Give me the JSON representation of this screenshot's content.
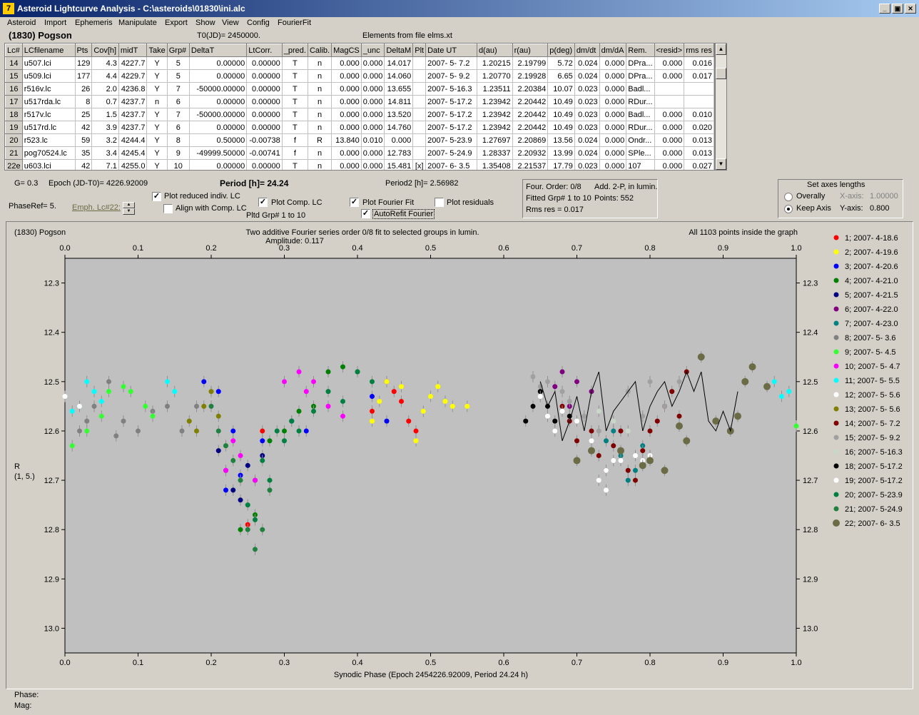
{
  "window": {
    "title": "Asteroid Lightcurve Analysis - C:\\asteroids\\01830\\ini.alc",
    "buttons": {
      "minimize": "_",
      "restore": "▣",
      "close": "✕"
    }
  },
  "menu": [
    "Asteroid",
    "Import",
    "Ephemeris",
    "Manipulate",
    "Export",
    "Show",
    "View",
    "Config",
    "FourierFit"
  ],
  "header": {
    "asteroid": "(1830) Pogson",
    "t0": "T0(JD)= 2450000.",
    "elements": "Elements from file elms.xt"
  },
  "table": {
    "columns": [
      "Lc#",
      "LCfilename",
      "Pts",
      "Cov[h]",
      "midT",
      "Take",
      "Grp#",
      "DeltaT",
      "LtCorr.",
      "_pred.",
      "Calib.",
      "MagCS",
      "_unc",
      "DeltaM",
      "Plt",
      "Date UT",
      "d(au)",
      "r(au)",
      "p(deg)",
      "dm/dt",
      "dm/dA",
      "Rem.",
      "<resid>",
      "rms res"
    ],
    "rows": [
      [
        "14",
        "u507.lci",
        "129",
        "4.3",
        "4227.7",
        "Y",
        "5",
        "0.00000",
        "0.00000",
        "T",
        "n",
        "0.000",
        "0.000",
        "14.017",
        "",
        "2007- 5- 7.2",
        "1.20215",
        "2.19799",
        "5.72",
        "0.024",
        "0.000",
        "DPra...",
        "0.000",
        "0.016"
      ],
      [
        "15",
        "u509.lci",
        "177",
        "4.4",
        "4229.7",
        "Y",
        "5",
        "0.00000",
        "0.00000",
        "T",
        "n",
        "0.000",
        "0.000",
        "14.060",
        "",
        "2007- 5- 9.2",
        "1.20770",
        "2.19928",
        "6.65",
        "0.024",
        "0.000",
        "DPra...",
        "0.000",
        "0.017"
      ],
      [
        "16",
        "r516v.lc",
        "26",
        "2.0",
        "4236.8",
        "Y",
        "7",
        "-50000.00000",
        "0.00000",
        "T",
        "n",
        "0.000",
        "0.000",
        "13.655",
        "",
        "2007- 5-16.3",
        "1.23511",
        "2.20384",
        "10.07",
        "0.023",
        "0.000",
        "Badl...",
        "",
        ""
      ],
      [
        "17",
        "u517rda.lc",
        "8",
        "0.7",
        "4237.7",
        "n",
        "6",
        "0.00000",
        "0.00000",
        "T",
        "n",
        "0.000",
        "0.000",
        "14.811",
        "",
        "2007- 5-17.2",
        "1.23942",
        "2.20442",
        "10.49",
        "0.023",
        "0.000",
        "RDur...",
        "",
        ""
      ],
      [
        "18",
        "r517v.lc",
        "25",
        "1.5",
        "4237.7",
        "Y",
        "7",
        "-50000.00000",
        "0.00000",
        "T",
        "n",
        "0.000",
        "0.000",
        "13.520",
        "",
        "2007- 5-17.2",
        "1.23942",
        "2.20442",
        "10.49",
        "0.023",
        "0.000",
        "Badl...",
        "0.000",
        "0.010"
      ],
      [
        "19",
        "u517rd.lc",
        "42",
        "3.9",
        "4237.7",
        "Y",
        "6",
        "0.00000",
        "0.00000",
        "T",
        "n",
        "0.000",
        "0.000",
        "14.760",
        "",
        "2007- 5-17.2",
        "1.23942",
        "2.20442",
        "10.49",
        "0.023",
        "0.000",
        "RDur...",
        "0.000",
        "0.020"
      ],
      [
        "20",
        "r523.lc",
        "59",
        "3.2",
        "4244.4",
        "Y",
        "8",
        "0.50000",
        "-0.00738",
        "f",
        "R",
        "13.840",
        "0.010",
        "0.000",
        "",
        "2007- 5-23.9",
        "1.27697",
        "2.20869",
        "13.56",
        "0.024",
        "0.000",
        "Ondr...",
        "0.000",
        "0.013"
      ],
      [
        "21",
        "pog70524.lc",
        "35",
        "3.4",
        "4245.4",
        "Y",
        "9",
        "-49999.50000",
        "-0.00741",
        "f",
        "n",
        "0.000",
        "0.000",
        "12.783",
        "",
        "2007- 5-24.9",
        "1.28337",
        "2.20932",
        "13.99",
        "0.024",
        "0.000",
        "SPle...",
        "0.000",
        "0.013"
      ],
      [
        "22e",
        "u603.lci",
        "42",
        "7.1",
        "4255.0",
        "Y",
        "10",
        "0.00000",
        "0.00000",
        "T",
        "n",
        "0.000",
        "0.000",
        "15.481",
        "[x]",
        "2007- 6- 3.5",
        "1.35408",
        "2.21537",
        "17.79",
        "0.023",
        "0.000",
        "107",
        "0.000",
        "0.027"
      ]
    ]
  },
  "controls": {
    "g": "G= 0.3",
    "epoch": "Epoch (JD-T0)= 4226.92009",
    "period": "Period [h]= 24.24",
    "period2": "Period2 [h]= 2.56982",
    "phaseref": "PhaseRef= 5.",
    "emph": "Emph. Lc#22:",
    "plot_reduced": "Plot reduced indiv. LC",
    "align": "Align with Comp. LC",
    "plot_comp": "Plot Comp. LC",
    "pltd_grp": "Pltd Grp#  1   to   10",
    "plot_fourier": "Plot Fourier Fit",
    "autorefit": "AutoRefit Fourier",
    "plot_residuals": "Plot residuals",
    "fourier_order": "Four. Order:  0/8",
    "add": "Add. 2-P, in lumin.",
    "fitted": "Fitted Grp# 1 to 10",
    "points": "Points: 552",
    "rms": "Rms res     = 0.017",
    "axes_title": "Set axes lengths",
    "overally": "Overally",
    "keep_axis": "Keep Axis",
    "x_axis_label": "X-axis:",
    "x_axis_value": "1.00000",
    "y_axis_label": "Y-axis:",
    "y_axis_value": "0.800"
  },
  "status": {
    "phase": "Phase:",
    "mag": "Mag:"
  },
  "chart_data": {
    "type": "scatter",
    "title_left": "(1830) Pogson",
    "title_center": "Two additive Fourier series order 0/8 fit to selected groups in lumin.",
    "amplitude": "Amplitude: 0.117",
    "title_right": "All 1103 points inside the graph",
    "xlabel": "Synodic Phase (Epoch 2454226.92009, Period 24.24 h)",
    "ylabel_top": "R",
    "ylabel_bottom": "(1, 5.)",
    "xlim": [
      0,
      1
    ],
    "ylim": [
      12.25,
      13.05
    ],
    "y_inverted": true,
    "xticks": [
      "0.0",
      "0.1",
      "0.2",
      "0.3",
      "0.4",
      "0.5",
      "0.6",
      "0.7",
      "0.8",
      "0.9",
      "1.0"
    ],
    "yticks": [
      "12.3",
      "12.4",
      "12.5",
      "12.6",
      "12.7",
      "12.8",
      "12.9",
      "13.0"
    ],
    "background": "#c0c0c0",
    "legend_position": "right",
    "series": [
      {
        "name": "1; 2007- 4-18.6",
        "color": "#ff0000",
        "x": [
          0.44,
          0.45,
          0.47,
          0.48,
          0.42,
          0.46,
          0.25,
          0.27
        ],
        "y": [
          12.5,
          12.52,
          12.58,
          12.6,
          12.56,
          12.54,
          12.79,
          12.6
        ]
      },
      {
        "name": "2; 2007- 4-19.6",
        "color": "#ffff00",
        "x": [
          0.44,
          0.46,
          0.5,
          0.51,
          0.52,
          0.53,
          0.55,
          0.43,
          0.49,
          0.48,
          0.42
        ],
        "y": [
          12.5,
          12.51,
          12.53,
          12.51,
          12.54,
          12.55,
          12.55,
          12.54,
          12.56,
          12.62,
          12.58
        ]
      },
      {
        "name": "3; 2007- 4-20.6",
        "color": "#0000ff",
        "x": [
          0.19,
          0.21,
          0.23,
          0.27,
          0.31,
          0.33,
          0.44,
          0.42,
          0.22,
          0.24
        ],
        "y": [
          12.5,
          12.52,
          12.6,
          12.62,
          12.58,
          12.6,
          12.58,
          12.53,
          12.72,
          12.69
        ]
      },
      {
        "name": "4; 2007- 4-21.0",
        "color": "#008000",
        "x": [
          0.36,
          0.38,
          0.4,
          0.34,
          0.3,
          0.32,
          0.28,
          0.26,
          0.24
        ],
        "y": [
          12.48,
          12.47,
          12.48,
          12.55,
          12.6,
          12.56,
          12.62,
          12.77,
          12.8
        ]
      },
      {
        "name": "5; 2007- 4-21.5",
        "color": "#000080",
        "x": [
          0.22,
          0.23,
          0.25,
          0.26,
          0.27,
          0.21,
          0.24
        ],
        "y": [
          12.68,
          12.72,
          12.67,
          12.7,
          12.65,
          12.64,
          12.74
        ]
      },
      {
        "name": "6; 2007- 4-22.0",
        "color": "#800080",
        "x": [
          0.68,
          0.7,
          0.69,
          0.72,
          0.67
        ],
        "y": [
          12.48,
          12.5,
          12.55,
          12.52,
          12.51
        ]
      },
      {
        "name": "7; 2007- 4-23.0",
        "color": "#008080",
        "x": [
          0.75,
          0.76,
          0.77,
          0.74,
          0.78,
          0.79
        ],
        "y": [
          12.6,
          12.65,
          12.7,
          12.62,
          12.68,
          12.63
        ]
      },
      {
        "name": "8; 2007- 5- 3.6",
        "color": "#808080",
        "x": [
          0.02,
          0.04,
          0.06,
          0.08,
          0.1,
          0.12,
          0.14,
          0.16,
          0.18,
          0.03,
          0.07
        ],
        "y": [
          12.6,
          12.55,
          12.5,
          12.58,
          12.6,
          12.56,
          12.55,
          12.6,
          12.55,
          12.58,
          12.61
        ]
      },
      {
        "name": "9; 2007- 5- 4.5",
        "color": "#33ff33",
        "x": [
          0.06,
          0.08,
          0.09,
          0.11,
          0.12,
          0.01,
          0.03,
          0.05,
          1.0
        ],
        "y": [
          12.52,
          12.51,
          12.52,
          12.55,
          12.57,
          12.63,
          12.6,
          12.57,
          12.59
        ]
      },
      {
        "name": "10; 2007- 5- 4.7",
        "color": "#ff00ff",
        "x": [
          0.3,
          0.32,
          0.34,
          0.22,
          0.24,
          0.26,
          0.33,
          0.36,
          0.38,
          0.23
        ],
        "y": [
          12.5,
          12.48,
          12.5,
          12.68,
          12.65,
          12.7,
          12.52,
          12.55,
          12.57,
          12.62
        ]
      },
      {
        "name": "11; 2007- 5- 5.5",
        "color": "#00ffff",
        "x": [
          0.01,
          0.02,
          0.03,
          0.04,
          0.05,
          0.14,
          0.15,
          0.97,
          0.98,
          0.99
        ],
        "y": [
          12.56,
          12.55,
          12.5,
          12.52,
          12.54,
          12.5,
          12.52,
          12.5,
          12.53,
          12.52
        ]
      },
      {
        "name": "12; 2007- 5- 5.6",
        "color": "#ffffff",
        "x": [
          0.0,
          0.02,
          0.64,
          0.66,
          0.67,
          0.73,
          0.74,
          0.75,
          0.79,
          0.8
        ],
        "y": [
          12.53,
          12.55,
          12.55,
          12.57,
          12.6,
          12.7,
          12.72,
          12.66,
          12.66,
          12.65
        ]
      },
      {
        "name": "13; 2007- 5- 5.6",
        "color": "#808000",
        "x": [
          0.17,
          0.18,
          0.19,
          0.2,
          0.22,
          0.21
        ],
        "y": [
          12.58,
          12.6,
          12.55,
          12.52,
          12.63,
          12.57
        ]
      },
      {
        "name": "14; 2007- 5- 7.2",
        "color": "#800000",
        "x": [
          0.68,
          0.69,
          0.7,
          0.72,
          0.73,
          0.74,
          0.75,
          0.76,
          0.77,
          0.78,
          0.79,
          0.8,
          0.81,
          0.82,
          0.83,
          0.84,
          0.85
        ],
        "y": [
          12.55,
          12.58,
          12.62,
          12.6,
          12.65,
          12.68,
          12.63,
          12.6,
          12.68,
          12.7,
          12.64,
          12.6,
          12.58,
          12.55,
          12.52,
          12.57,
          12.48
        ]
      },
      {
        "name": "15; 2007- 5- 9.2",
        "color": "#a0a0a0",
        "x": [
          0.64,
          0.65,
          0.66,
          0.68,
          0.69,
          0.71,
          0.73,
          0.77,
          0.79,
          0.8,
          0.82,
          0.84
        ],
        "y": [
          12.49,
          12.51,
          12.5,
          12.52,
          12.54,
          12.57,
          12.6,
          12.52,
          12.57,
          12.5,
          12.55,
          12.5
        ]
      },
      {
        "name": "16; 2007- 5-16.3",
        "color": "#c8d8c8",
        "x": [
          0.73,
          0.75,
          0.77
        ],
        "y": [
          12.56,
          12.58,
          12.6
        ]
      },
      {
        "name": "18; 2007- 5-17.2",
        "color": "#000000",
        "x": [
          0.63,
          0.64,
          0.65,
          0.66,
          0.67,
          0.69
        ],
        "y": [
          12.58,
          12.55,
          12.52,
          12.55,
          12.58,
          12.57
        ]
      },
      {
        "name": "19; 2007- 5-17.2",
        "color": "#ffffff",
        "x": [
          0.65,
          0.68,
          0.7,
          0.72,
          0.74,
          0.76,
          0.78
        ],
        "y": [
          12.53,
          12.56,
          12.58,
          12.62,
          12.68,
          12.66,
          12.65
        ]
      },
      {
        "name": "20; 2007- 5-23.9",
        "color": "#008040",
        "x": [
          0.26,
          0.28,
          0.3,
          0.32,
          0.34,
          0.36,
          0.38,
          0.4,
          0.42,
          0.25,
          0.27,
          0.29,
          0.31
        ],
        "y": [
          12.78,
          12.7,
          12.62,
          12.6,
          12.56,
          12.52,
          12.54,
          12.48,
          12.5,
          12.75,
          12.66,
          12.6,
          12.58
        ]
      },
      {
        "name": "21; 2007- 5-24.9",
        "color": "#208040",
        "x": [
          0.2,
          0.21,
          0.22,
          0.23,
          0.24,
          0.25,
          0.26,
          0.27,
          0.28
        ],
        "y": [
          12.55,
          12.6,
          12.63,
          12.66,
          12.7,
          12.8,
          12.84,
          12.8,
          12.72
        ]
      },
      {
        "name": "22; 2007- 6- 3.5",
        "color": "#6b6b45",
        "x": [
          0.7,
          0.72,
          0.76,
          0.79,
          0.8,
          0.84,
          0.85,
          0.87,
          0.89,
          0.91,
          0.92,
          0.94,
          0.96,
          0.93,
          0.82
        ],
        "y": [
          12.66,
          12.64,
          12.64,
          12.67,
          12.66,
          12.59,
          12.62,
          12.45,
          12.58,
          12.6,
          12.57,
          12.47,
          12.51,
          12.5,
          12.68
        ]
      }
    ],
    "fourier_fit": {
      "color": "#000000",
      "x": [
        0.65,
        0.66,
        0.67,
        0.68,
        0.69,
        0.7,
        0.71,
        0.72,
        0.73,
        0.74,
        0.75,
        0.76,
        0.77,
        0.78,
        0.79,
        0.8,
        0.81,
        0.82,
        0.83,
        0.84,
        0.85,
        0.86,
        0.87,
        0.88,
        0.89,
        0.9,
        0.91,
        0.92
      ],
      "y": [
        12.5,
        12.55,
        12.52,
        12.62,
        12.58,
        12.53,
        12.6,
        12.52,
        12.48,
        12.6,
        12.56,
        12.54,
        12.52,
        12.5,
        12.6,
        12.55,
        12.52,
        12.5,
        12.55,
        12.52,
        12.48,
        12.52,
        12.48,
        12.58,
        12.6,
        12.56,
        12.6,
        12.52
      ]
    }
  }
}
